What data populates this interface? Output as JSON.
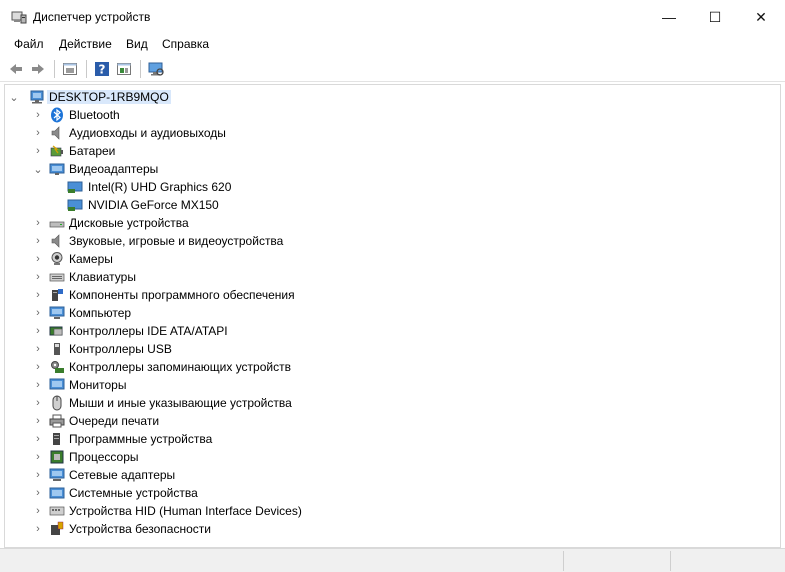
{
  "window": {
    "title": "Диспетчер устройств",
    "minimize_glyph": "—",
    "maximize_glyph": "☐",
    "close_glyph": "✕"
  },
  "menu": [
    "Файл",
    "Действие",
    "Вид",
    "Справка"
  ],
  "toolbar": {
    "buttons": [
      "back-icon",
      "forward-icon",
      "properties-icon",
      "help-icon",
      "update-driver-icon",
      "scan-hardware-icon"
    ]
  },
  "tree": {
    "root": "DESKTOP-1RB9MQO",
    "categories": [
      {
        "label": "Bluetooth",
        "icon": "bluetooth-icon",
        "expanded": false
      },
      {
        "label": "Аудиовходы и аудиовыходы",
        "icon": "audio-io-icon",
        "expanded": false
      },
      {
        "label": "Батареи",
        "icon": "battery-icon",
        "expanded": false
      },
      {
        "label": "Видеоадаптеры",
        "icon": "display-adapter-icon",
        "expanded": true,
        "children": [
          "Intel(R) UHD Graphics 620",
          "NVIDIA GeForce MX150"
        ]
      },
      {
        "label": "Дисковые устройства",
        "icon": "disk-drive-icon",
        "expanded": false
      },
      {
        "label": "Звуковые, игровые и видеоустройства",
        "icon": "sound-icon",
        "expanded": false
      },
      {
        "label": "Камеры",
        "icon": "camera-icon",
        "expanded": false
      },
      {
        "label": "Клавиатуры",
        "icon": "keyboard-icon",
        "expanded": false
      },
      {
        "label": "Компоненты программного обеспечения",
        "icon": "software-component-icon",
        "expanded": false
      },
      {
        "label": "Компьютер",
        "icon": "computer-icon",
        "expanded": false
      },
      {
        "label": "Контроллеры IDE ATA/ATAPI",
        "icon": "ide-controller-icon",
        "expanded": false
      },
      {
        "label": "Контроллеры USB",
        "icon": "usb-icon",
        "expanded": false
      },
      {
        "label": "Контроллеры запоминающих устройств",
        "icon": "storage-controller-icon",
        "expanded": false
      },
      {
        "label": "Мониторы",
        "icon": "monitor-icon",
        "expanded": false
      },
      {
        "label": "Мыши и иные указывающие устройства",
        "icon": "mouse-icon",
        "expanded": false
      },
      {
        "label": "Очереди печати",
        "icon": "printer-icon",
        "expanded": false
      },
      {
        "label": "Программные устройства",
        "icon": "software-device-icon",
        "expanded": false
      },
      {
        "label": "Процессоры",
        "icon": "processor-icon",
        "expanded": false
      },
      {
        "label": "Сетевые адаптеры",
        "icon": "network-adapter-icon",
        "expanded": false
      },
      {
        "label": "Системные устройства",
        "icon": "system-device-icon",
        "expanded": false
      },
      {
        "label": "Устройства HID (Human Interface Devices)",
        "icon": "hid-icon",
        "expanded": false
      },
      {
        "label": "Устройства безопасности",
        "icon": "security-device-icon",
        "expanded": false
      }
    ]
  },
  "colors": {
    "selection": "#d9e8fb",
    "bluetooth": "#1d74d8",
    "monitor": "#4a8fd6",
    "pcb_green": "#3a7d2c"
  }
}
